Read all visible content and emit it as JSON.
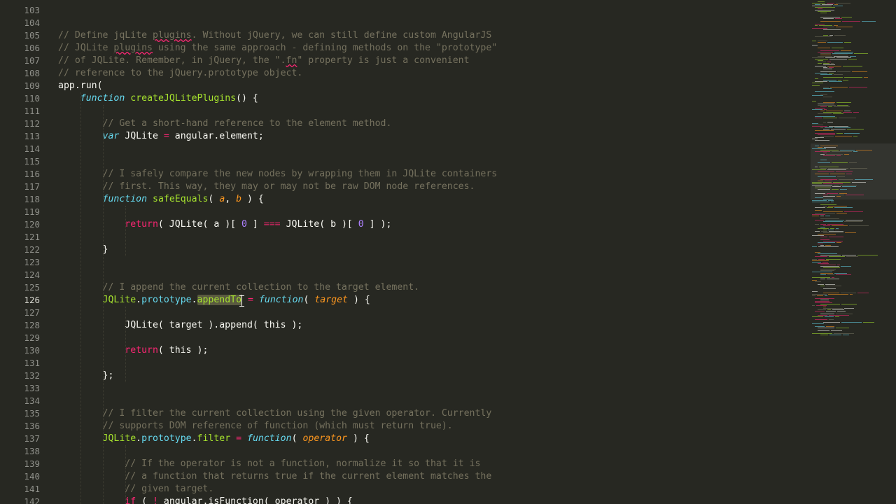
{
  "editor": {
    "theme_colors": {
      "background": "#272822",
      "comment": "#75715e",
      "keyword": "#f92672",
      "storage": "#66d9ef",
      "function": "#a6e22e",
      "parameter": "#fd971f",
      "number": "#ae81ff",
      "plain": "#f8f8f2",
      "gutter_text": "#8f908a"
    },
    "current_line": 126,
    "lines": [
      {
        "num": "103",
        "tokens": []
      },
      {
        "num": "104",
        "tokens": []
      },
      {
        "num": "105",
        "tokens": [
          {
            "t": "// Define jqLite ",
            "c": "comment"
          },
          {
            "t": "plugins",
            "c": "comment squiggle"
          },
          {
            "t": ". Without jQuery, we can still define custom AngularJS",
            "c": "comment"
          }
        ]
      },
      {
        "num": "106",
        "tokens": [
          {
            "t": "// JQLite ",
            "c": "comment"
          },
          {
            "t": "plugins",
            "c": "comment squiggle"
          },
          {
            "t": " using the same approach - defining methods on the \"prototype\"",
            "c": "comment"
          }
        ]
      },
      {
        "num": "107",
        "tokens": [
          {
            "t": "// of JQLite. Remember, in jQuery, the \".",
            "c": "comment"
          },
          {
            "t": "fn",
            "c": "comment squiggle"
          },
          {
            "t": "\" property is just a convenient",
            "c": "comment"
          }
        ]
      },
      {
        "num": "108",
        "tokens": [
          {
            "t": "// reference to the jQuery.prototype object.",
            "c": "comment"
          }
        ]
      },
      {
        "num": "109",
        "tokens": [
          {
            "t": "app.run(",
            "c": "plain"
          }
        ]
      },
      {
        "num": "110",
        "tokens": [
          {
            "t": "    ",
            "c": "plain"
          },
          {
            "t": "function",
            "c": "storage"
          },
          {
            "t": " ",
            "c": "plain"
          },
          {
            "t": "createJQLitePlugins",
            "c": "func"
          },
          {
            "t": "() {",
            "c": "plain"
          }
        ]
      },
      {
        "num": "111",
        "tokens": []
      },
      {
        "num": "112",
        "tokens": [
          {
            "t": "        ",
            "c": "plain"
          },
          {
            "t": "// Get a short-hand reference to the element method.",
            "c": "comment"
          }
        ]
      },
      {
        "num": "113",
        "tokens": [
          {
            "t": "        ",
            "c": "plain"
          },
          {
            "t": "var",
            "c": "storage"
          },
          {
            "t": " JQLite ",
            "c": "plain"
          },
          {
            "t": "=",
            "c": "keyword"
          },
          {
            "t": " angular.element;",
            "c": "plain"
          }
        ]
      },
      {
        "num": "114",
        "tokens": []
      },
      {
        "num": "115",
        "tokens": []
      },
      {
        "num": "116",
        "tokens": [
          {
            "t": "        ",
            "c": "plain"
          },
          {
            "t": "// I safely compare the new nodes by wrapping them in JQLite containers",
            "c": "comment"
          }
        ]
      },
      {
        "num": "117",
        "tokens": [
          {
            "t": "        ",
            "c": "plain"
          },
          {
            "t": "// first. This way, they may or may not be raw DOM node references.",
            "c": "comment"
          }
        ]
      },
      {
        "num": "118",
        "tokens": [
          {
            "t": "        ",
            "c": "plain"
          },
          {
            "t": "function",
            "c": "storage"
          },
          {
            "t": " ",
            "c": "plain"
          },
          {
            "t": "safeEquals",
            "c": "func"
          },
          {
            "t": "( ",
            "c": "plain"
          },
          {
            "t": "a",
            "c": "param"
          },
          {
            "t": ", ",
            "c": "plain"
          },
          {
            "t": "b",
            "c": "param"
          },
          {
            "t": " ) {",
            "c": "plain"
          }
        ]
      },
      {
        "num": "119",
        "tokens": []
      },
      {
        "num": "120",
        "tokens": [
          {
            "t": "            ",
            "c": "plain"
          },
          {
            "t": "return",
            "c": "keyword"
          },
          {
            "t": "( JQLite( a )[ ",
            "c": "plain"
          },
          {
            "t": "0",
            "c": "number"
          },
          {
            "t": " ] ",
            "c": "plain"
          },
          {
            "t": "===",
            "c": "keyword"
          },
          {
            "t": " JQLite( b )[ ",
            "c": "plain"
          },
          {
            "t": "0",
            "c": "number"
          },
          {
            "t": " ] );",
            "c": "plain"
          }
        ]
      },
      {
        "num": "121",
        "tokens": []
      },
      {
        "num": "122",
        "tokens": [
          {
            "t": "        }",
            "c": "plain"
          }
        ]
      },
      {
        "num": "123",
        "tokens": []
      },
      {
        "num": "124",
        "tokens": []
      },
      {
        "num": "125",
        "tokens": [
          {
            "t": "        ",
            "c": "plain"
          },
          {
            "t": "// I append the current collection to the target element.",
            "c": "comment"
          }
        ]
      },
      {
        "num": "126",
        "tokens": [
          {
            "t": "        ",
            "c": "plain"
          },
          {
            "t": "JQLite",
            "c": "func"
          },
          {
            "t": ".",
            "c": "plain"
          },
          {
            "t": "prototype",
            "c": "support"
          },
          {
            "t": ".",
            "c": "plain"
          },
          {
            "t": "appendTo",
            "c": "highlight"
          },
          {
            "t": "",
            "c": "cursor"
          },
          {
            "t": " ",
            "c": "plain"
          },
          {
            "t": "=",
            "c": "keyword"
          },
          {
            "t": " ",
            "c": "plain"
          },
          {
            "t": "function",
            "c": "storage"
          },
          {
            "t": "( ",
            "c": "plain"
          },
          {
            "t": "target",
            "c": "param"
          },
          {
            "t": " ) {",
            "c": "plain"
          }
        ]
      },
      {
        "num": "127",
        "tokens": []
      },
      {
        "num": "128",
        "tokens": [
          {
            "t": "            JQLite( target ).append( this );",
            "c": "plain"
          }
        ]
      },
      {
        "num": "129",
        "tokens": []
      },
      {
        "num": "130",
        "tokens": [
          {
            "t": "            ",
            "c": "plain"
          },
          {
            "t": "return",
            "c": "keyword"
          },
          {
            "t": "( this );",
            "c": "plain"
          }
        ]
      },
      {
        "num": "131",
        "tokens": []
      },
      {
        "num": "132",
        "tokens": [
          {
            "t": "        };",
            "c": "plain"
          }
        ]
      },
      {
        "num": "133",
        "tokens": []
      },
      {
        "num": "134",
        "tokens": []
      },
      {
        "num": "135",
        "tokens": [
          {
            "t": "        ",
            "c": "plain"
          },
          {
            "t": "// I filter the current collection using the given operator. Currently",
            "c": "comment"
          }
        ]
      },
      {
        "num": "136",
        "tokens": [
          {
            "t": "        ",
            "c": "plain"
          },
          {
            "t": "// supports DOM reference of function (which must return true).",
            "c": "comment"
          }
        ]
      },
      {
        "num": "137",
        "tokens": [
          {
            "t": "        ",
            "c": "plain"
          },
          {
            "t": "JQLite",
            "c": "func"
          },
          {
            "t": ".",
            "c": "plain"
          },
          {
            "t": "prototype",
            "c": "support"
          },
          {
            "t": ".",
            "c": "plain"
          },
          {
            "t": "filter",
            "c": "func"
          },
          {
            "t": " ",
            "c": "plain"
          },
          {
            "t": "=",
            "c": "keyword"
          },
          {
            "t": " ",
            "c": "plain"
          },
          {
            "t": "function",
            "c": "storage"
          },
          {
            "t": "( ",
            "c": "plain"
          },
          {
            "t": "operator",
            "c": "param"
          },
          {
            "t": " ) {",
            "c": "plain"
          }
        ]
      },
      {
        "num": "138",
        "tokens": []
      },
      {
        "num": "139",
        "tokens": [
          {
            "t": "            ",
            "c": "plain"
          },
          {
            "t": "// If the operator is not a function, normalize it so that it is",
            "c": "comment"
          }
        ]
      },
      {
        "num": "140",
        "tokens": [
          {
            "t": "            ",
            "c": "plain"
          },
          {
            "t": "// a function that returns true if the current element matches the",
            "c": "comment"
          }
        ]
      },
      {
        "num": "141",
        "tokens": [
          {
            "t": "            ",
            "c": "plain"
          },
          {
            "t": "// given target.",
            "c": "comment"
          }
        ]
      },
      {
        "num": "142",
        "tokens": [
          {
            "t": "            ",
            "c": "plain"
          },
          {
            "t": "if",
            "c": "keyword"
          },
          {
            "t": " ( ",
            "c": "plain"
          },
          {
            "t": "!",
            "c": "keyword"
          },
          {
            "t": " angular.isFunction( operator ) ) {",
            "c": "plain"
          }
        ]
      }
    ]
  },
  "minimap": {
    "label": "minimap"
  }
}
